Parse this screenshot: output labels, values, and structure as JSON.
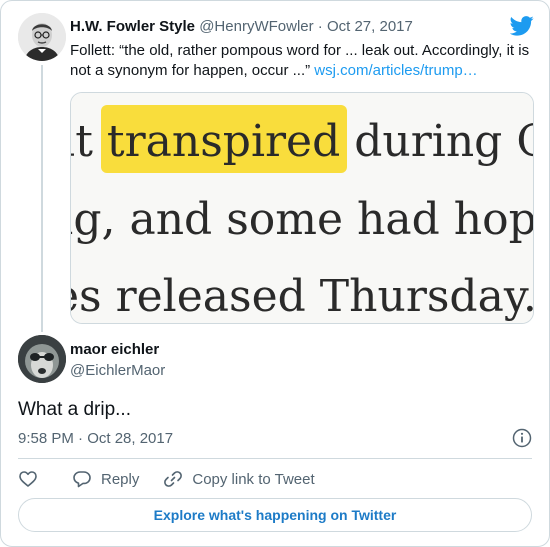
{
  "quoted_tweet": {
    "author_name": "H.W. Fowler Style",
    "author_handle": "@HenryWFowler",
    "date": "Oct 27, 2017",
    "separator": "·",
    "text": "Follett: “the old, rather pompous word for ... leak out. Accordingly, it is not a synonym for happen, occur ...”",
    "link_text": "wsj.com/articles/trump…",
    "media": {
      "line1_before": "at ",
      "line1_highlight": "transpired",
      "line1_after": " during O",
      "line2": "ng, and some had hope",
      "line3": "es released Thursday.",
      "highlight_color": "#f9dd3c"
    }
  },
  "tweet": {
    "author_name": "maor eichler",
    "author_handle": "@EichlerMaor",
    "text": "What a drip...",
    "timestamp": "9:58 PM · Oct 28, 2017"
  },
  "actions": {
    "reply_label": "Reply",
    "copy_link_label": "Copy link to Tweet"
  },
  "explore_label": "Explore what's happening on Twitter",
  "colors": {
    "accent": "#1d9bf0",
    "secondary_text": "#536471",
    "border": "#cfd9de"
  },
  "icons": [
    "twitter-bird-icon",
    "info-icon",
    "heart-icon",
    "reply-icon",
    "link-icon"
  ]
}
